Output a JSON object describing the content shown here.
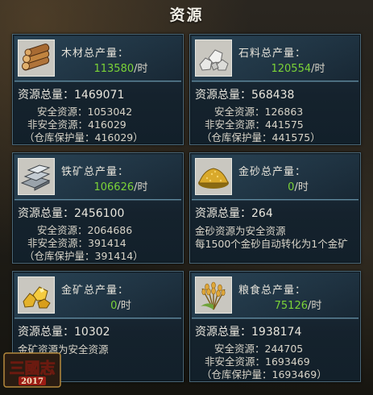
{
  "title": "资源",
  "per_hour": "/时",
  "labels": {
    "total": "资源总量：",
    "safe": "安全资源：",
    "unsafe": "非安全资源：",
    "protect_prefix": "（仓库保护量：",
    "protect_suffix": "）"
  },
  "panels": [
    {
      "name": "木材总产量：",
      "icon": "wood-icon",
      "rate": "113580",
      "total": "1469071",
      "safe": "1053042",
      "unsafe": "416029",
      "protect": "416029"
    },
    {
      "name": "石料总产量：",
      "icon": "stone-icon",
      "rate": "120554",
      "total": "568438",
      "safe": "126863",
      "unsafe": "441575",
      "protect": "441575"
    },
    {
      "name": "铁矿总产量：",
      "icon": "iron-icon",
      "rate": "106626",
      "total": "2456100",
      "safe": "2064686",
      "unsafe": "391414",
      "protect": "391414"
    },
    {
      "name": "金砂总产量：",
      "icon": "gold-sand-icon",
      "rate": "0",
      "total": "264",
      "note1": "金砂资源为安全资源",
      "note2": "每1500个金砂自动转化为1个金矿"
    },
    {
      "name": "金矿总产量：",
      "icon": "gold-ore-icon",
      "rate": "0",
      "total": "10302",
      "note1": "金矿资源为安全资源"
    },
    {
      "name": "粮食总产量：",
      "icon": "grain-icon",
      "rate": "75126",
      "total": "1938174",
      "safe": "244705",
      "unsafe": "1693469",
      "protect": "1693469"
    }
  ],
  "logo": {
    "text": "三國志",
    "year": "2017"
  }
}
